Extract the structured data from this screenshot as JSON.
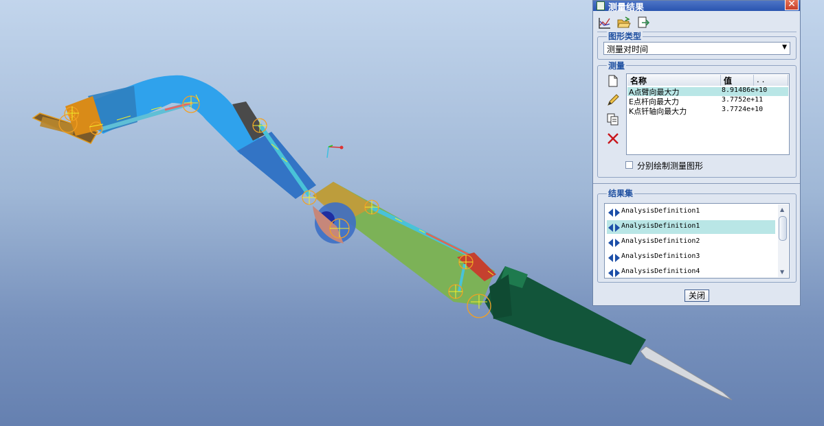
{
  "dialog": {
    "title": "测量结果",
    "close_glyph": "✕",
    "toolbar": {
      "icons": [
        "graph-icon",
        "open-folder-icon",
        "export-icon"
      ]
    },
    "plot_type": {
      "label": "图形类型",
      "value": "测量对时间"
    },
    "measures": {
      "label": "测量",
      "columns": [
        "名称",
        "值",
        ". ."
      ],
      "rows": [
        {
          "name": "A点臂向最大力",
          "value": "8.91486e+10"
        },
        {
          "name": "E点杆向最大力",
          "value": "3.7752e+11"
        },
        {
          "name": "K点钎轴向最大力",
          "value": "3.7724e+10"
        }
      ],
      "selected_row": 0,
      "side_icons": [
        "new-icon",
        "edit-icon",
        "copy-icon",
        "delete-icon"
      ],
      "separate_plot_label": "分别绘制测量图形",
      "separate_plot_checked": false
    },
    "result_set": {
      "label": "结果集",
      "items": [
        "AnalysisDefinition1",
        "AnalysisDefinition1",
        "AnalysisDefinition2",
        "AnalysisDefinition3",
        "AnalysisDefinition4"
      ],
      "selected_item": 1
    },
    "close_button_label": "关闭"
  },
  "colors": {
    "title_bar": "#2a55b0",
    "selection": "#b9e6e6",
    "model_blue": "#2fa2ec",
    "model_green": "#7cb257",
    "model_dark_green": "#12553a"
  }
}
